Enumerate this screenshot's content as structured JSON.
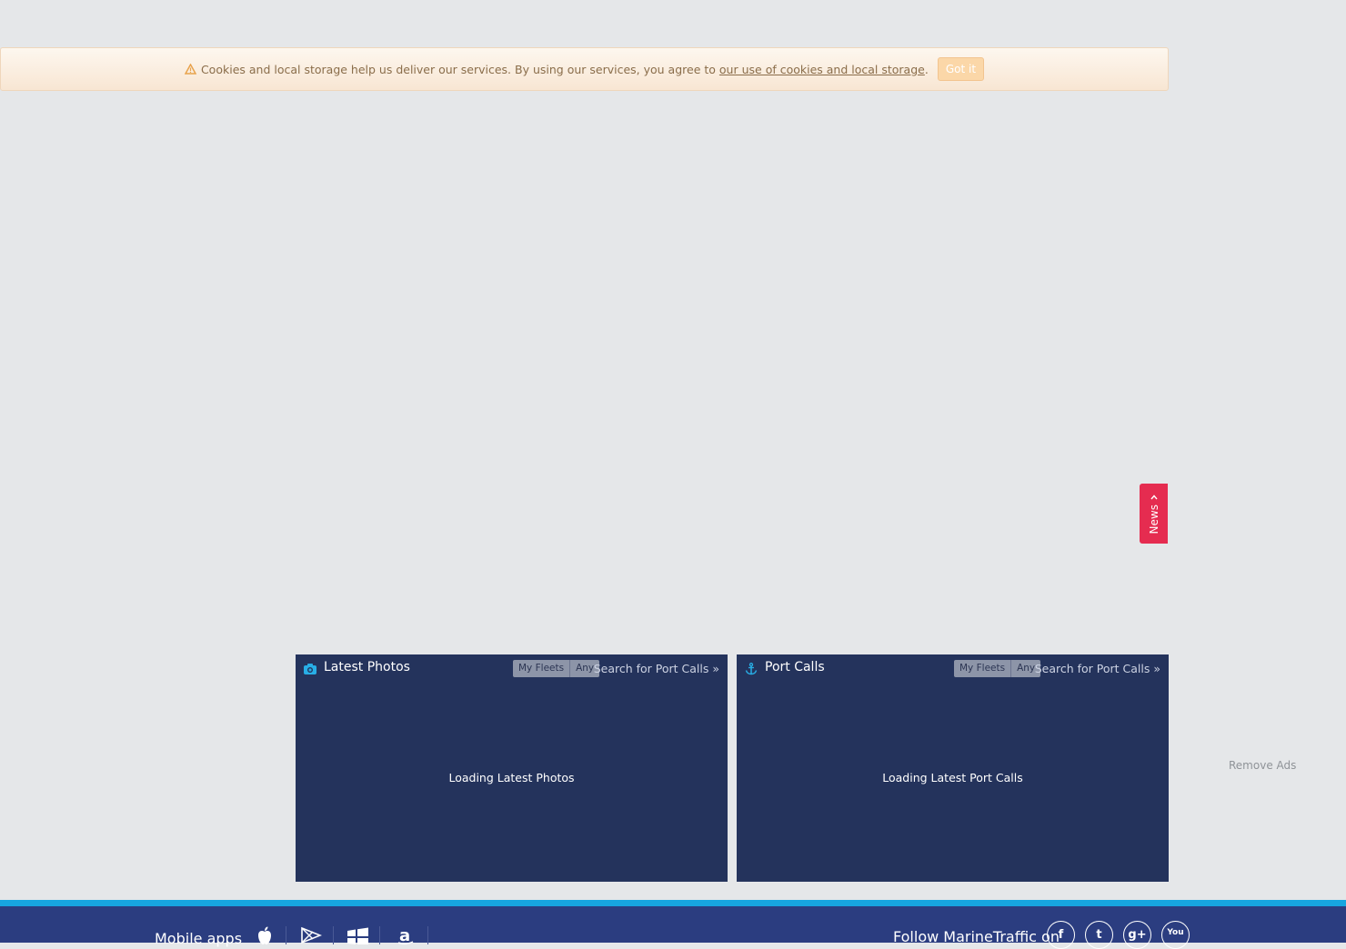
{
  "cookie": {
    "text": "Cookies and local storage help us deliver our services. By using our services, you agree to",
    "link_text": "our use of cookies and local storage",
    "period": ".",
    "button": "Got it"
  },
  "news_tab": {
    "label": "News"
  },
  "panels": {
    "photos": {
      "title": "Latest Photos",
      "filter_options": [
        "My Fleets",
        "Any"
      ],
      "search_link": "Search for Port Calls »",
      "loading": "Loading Latest Photos"
    },
    "calls": {
      "title": "Port Calls",
      "filter_options": [
        "My Fleets",
        "Any"
      ],
      "search_link": "Search for Port Calls »",
      "loading": "Loading Latest Port Calls"
    }
  },
  "remove_ads": "Remove Ads",
  "footer": {
    "mobile_apps": "Mobile apps",
    "follow": "Follow MarineTraffic on",
    "app_icons": [
      "apple-icon",
      "google-play-icon",
      "windows-icon",
      "amazon-icon"
    ],
    "social_icons": [
      "facebook-icon",
      "twitter-icon",
      "google-plus-icon",
      "youtube-icon"
    ],
    "social_glyphs": [
      "f",
      "t",
      "g+",
      "You"
    ]
  },
  "colors": {
    "background": "#e5e7e9",
    "panel": "#24335c",
    "news_tab": "#e52c50",
    "footer": "#2b3d80",
    "footer_line": "#17a5e0",
    "accent_icon": "#28aee6"
  }
}
